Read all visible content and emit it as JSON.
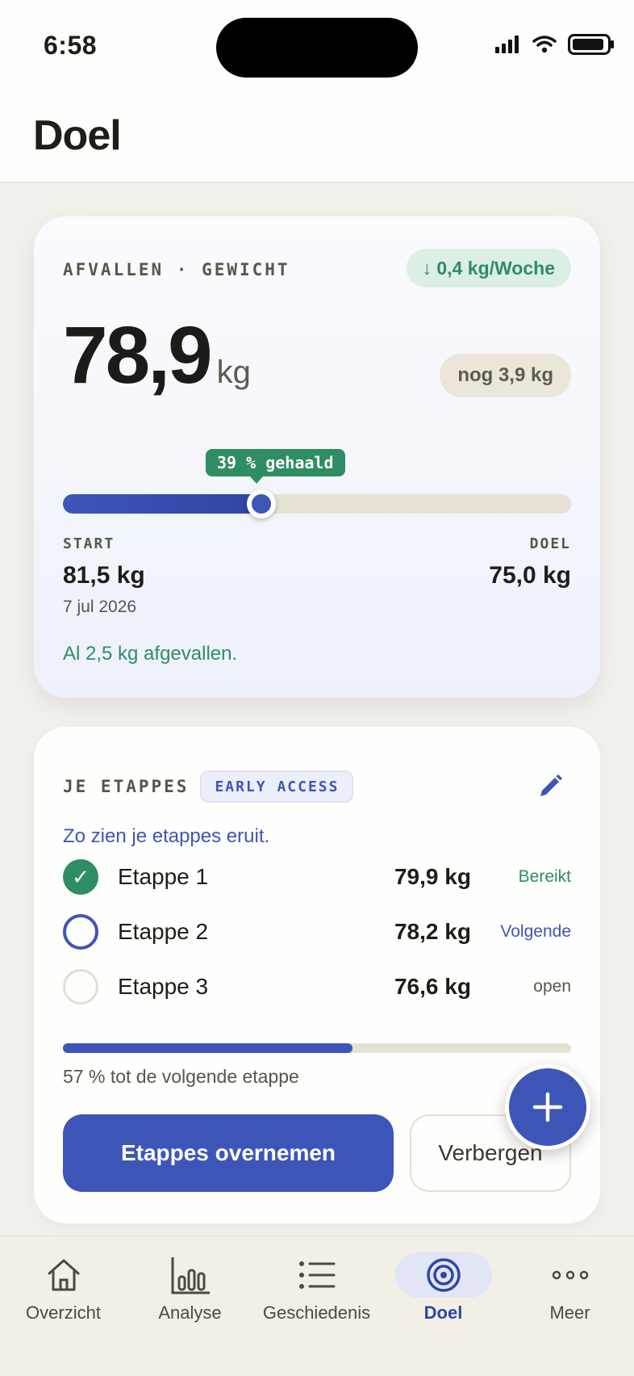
{
  "status_bar": {
    "time": "6:58"
  },
  "header": {
    "title": "Doel"
  },
  "goal_card": {
    "eyebrow": "AFVALLEN · GEWICHT",
    "rate": "↓ 0,4 kg/Woche",
    "current_weight": "78,9",
    "unit": "kg",
    "remaining": "nog 3,9 kg",
    "progress_label": "39 % gehaald",
    "progress_fraction": 0.39,
    "start_label": "START",
    "start_value": "81,5 kg",
    "start_date": "7 jul 2026",
    "goal_label": "DOEL",
    "goal_value": "75,0 kg",
    "lost_note": "Al 2,5 kg afgevallen."
  },
  "stages_card": {
    "title": "JE ETAPPES",
    "badge": "EARLY ACCESS",
    "subtitle": "Zo zien je etappes eruit.",
    "stages": [
      {
        "name": "Etappe 1",
        "weight": "79,9 kg",
        "status": "Bereikt",
        "state": "done",
        "mark": "✓"
      },
      {
        "name": "Etappe 2",
        "weight": "78,2 kg",
        "status": "Volgende",
        "state": "next"
      },
      {
        "name": "Etappe 3",
        "weight": "76,6 kg",
        "status": "open",
        "state": "open"
      }
    ],
    "progress_fraction": 0.57,
    "progress_text": "57 % tot de volgende etappe",
    "primary_button": "Etappes overnemen",
    "secondary_button": "Verbergen"
  },
  "tab_bar": {
    "tabs": [
      {
        "label": "Overzicht",
        "icon": "home-icon",
        "active": false
      },
      {
        "label": "Analyse",
        "icon": "bar-chart-icon",
        "active": false
      },
      {
        "label": "Geschiedenis",
        "icon": "list-icon",
        "active": false
      },
      {
        "label": "Doel",
        "icon": "target-icon",
        "active": true
      },
      {
        "label": "Meer",
        "icon": "more-icon",
        "active": false
      }
    ]
  },
  "colors": {
    "accent": "#3e55b8",
    "success": "#2f8d63",
    "background": "#f3f1eb"
  }
}
